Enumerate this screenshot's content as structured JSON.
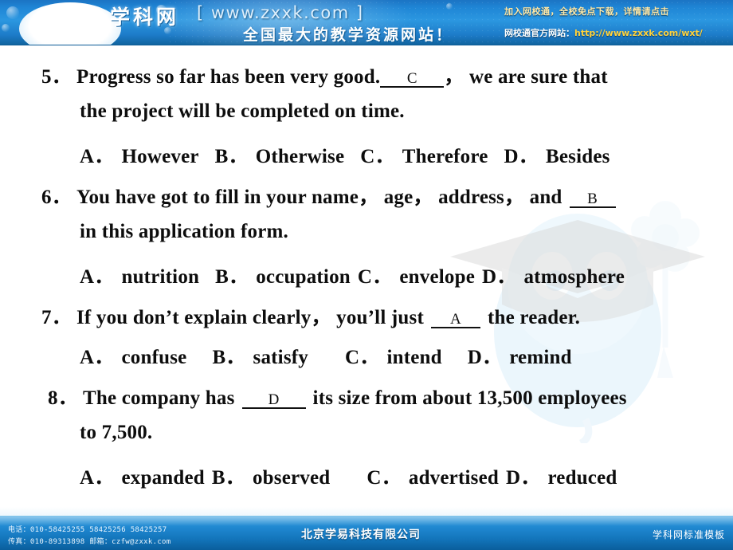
{
  "header": {
    "logo_cn": "学科网",
    "logo_url": "[ www.zxxk.com ]",
    "logo_sub": "全国最大的教学资源网站！",
    "promo_line1": "加入网校通，全校免点下载，详情请点击",
    "promo_line2_label": "网校通官方网站：",
    "promo_line2_link": "http://www.zxxk.com/wxt/",
    "mascot_alt": "mascot-icon"
  },
  "questions": [
    {
      "number": "5．",
      "stem_before": "Progress so far has been very good.",
      "answer": "C",
      "stem_after": "，  we are sure that",
      "line2": "the project will be completed on time.",
      "options": [
        {
          "label": "A．",
          "text": "However"
        },
        {
          "label": "B．",
          "text": "Otherwise"
        },
        {
          "label": "C．",
          "text": "Therefore"
        },
        {
          "label": "D．",
          "text": "Besides"
        }
      ]
    },
    {
      "number": "6．",
      "stem_before": "You have got to fill in your name，  age，  address，  and",
      "answer": "B",
      "stem_after": "",
      "line2": " in this application form.",
      "options": [
        {
          "label": "A．",
          "text": "nutrition"
        },
        {
          "label": "B．",
          "text": "occupation"
        },
        {
          "label": "C．",
          "text": "envelope"
        },
        {
          "label": "D．",
          "text": "atmosphere"
        }
      ]
    },
    {
      "number": "7．",
      "stem_before": "If you don’t explain clearly，  you’ll just",
      "answer": "A",
      "stem_after": "the reader.",
      "line2": "",
      "options": [
        {
          "label": "A．",
          "text": "confuse"
        },
        {
          "label": "B．",
          "text": "satisfy"
        },
        {
          "label": "C．",
          "text": "intend"
        },
        {
          "label": "D．",
          "text": "remind"
        }
      ]
    },
    {
      "number": "8．",
      "stem_before": "The company has",
      "answer": "D",
      "stem_after": "its size from about 13,500 employees",
      "line2": "to 7,500.",
      "options": [
        {
          "label": "A．",
          "text": "expanded"
        },
        {
          "label": "B．",
          "text": "observed"
        },
        {
          "label": "C．",
          "text": "advertised"
        },
        {
          "label": "D．",
          "text": "reduced"
        }
      ]
    }
  ],
  "footer": {
    "phone_line": "电话：010-58425255  58425256  58425257",
    "fax_line": "传真：010-89313898   邮箱：czfw@zxxk.com",
    "company": "北京学易科技有限公司",
    "template": "学科网标准模板"
  },
  "colors": {
    "banner_blue": "#1f86d6",
    "footer_blue": "#1d84cd",
    "text_black": "#0d0d0d",
    "link_yellow": "#ffd23d"
  }
}
